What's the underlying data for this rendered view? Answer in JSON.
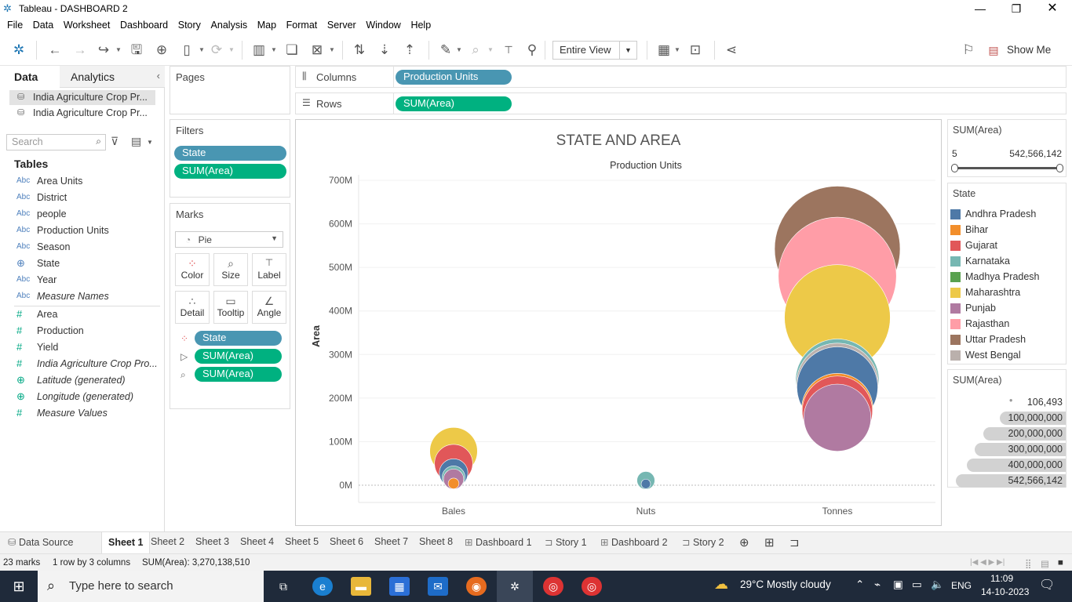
{
  "window": {
    "title": "Tableau - DASHBOARD 2"
  },
  "menu": [
    "File",
    "Data",
    "Worksheet",
    "Dashboard",
    "Story",
    "Analysis",
    "Map",
    "Format",
    "Server",
    "Window",
    "Help"
  ],
  "toolbar": {
    "view_fit": "Entire View",
    "show_me": "Show Me"
  },
  "left_panel": {
    "tab_data": "Data",
    "tab_analytics": "Analytics",
    "datasources": [
      "India Agriculture Crop Pr...",
      "India Agriculture Crop Pr..."
    ],
    "search_placeholder": "Search",
    "tables_heading": "Tables",
    "dimensions": [
      {
        "type": "Abc",
        "name": "Area Units"
      },
      {
        "type": "Abc",
        "name": "District"
      },
      {
        "type": "Abc",
        "name": "people"
      },
      {
        "type": "Abc",
        "name": "Production Units"
      },
      {
        "type": "Abc",
        "name": "Season"
      },
      {
        "type": "globe",
        "name": "State"
      },
      {
        "type": "Abc",
        "name": "Year"
      },
      {
        "type": "Abc",
        "name": "Measure Names"
      }
    ],
    "measures": [
      {
        "type": "#",
        "name": "Area"
      },
      {
        "type": "#",
        "name": "Production"
      },
      {
        "type": "#",
        "name": "Yield"
      },
      {
        "type": "#",
        "name": "India Agriculture Crop Pro..."
      },
      {
        "type": "globe",
        "name": "Latitude (generated)"
      },
      {
        "type": "globe",
        "name": "Longitude (generated)"
      },
      {
        "type": "#",
        "name": "Measure Values"
      }
    ]
  },
  "cards": {
    "pages": "Pages",
    "filters": "Filters",
    "filter_pills": [
      "State",
      "SUM(Area)"
    ],
    "marks": "Marks",
    "mark_type": "Pie",
    "mark_buttons": [
      "Color",
      "Size",
      "Label",
      "Detail",
      "Tooltip",
      "Angle"
    ],
    "mark_pills": [
      "State",
      "SUM(Area)",
      "SUM(Area)"
    ]
  },
  "shelves": {
    "columns_label": "Columns",
    "columns_pill": "Production Units",
    "rows_label": "Rows",
    "rows_pill": "SUM(Area)"
  },
  "chart_data": {
    "type": "scatter",
    "title": "STATE AND AREA",
    "subtitle": "Production Units",
    "ylabel": "Area",
    "categories": [
      "Bales",
      "Nuts",
      "Tonnes"
    ],
    "yticks": [
      "0M",
      "100M",
      "200M",
      "300M",
      "400M",
      "500M",
      "600M",
      "700M"
    ],
    "ylim": [
      0,
      700
    ],
    "unit": "millions",
    "points": [
      {
        "category": "Bales",
        "state": "Maharashtra",
        "y": 78
      },
      {
        "category": "Bales",
        "state": "Gujarat",
        "y": 50
      },
      {
        "category": "Bales",
        "state": "Andhra Pradesh",
        "y": 28
      },
      {
        "category": "Bales",
        "state": "Karnataka",
        "y": 18
      },
      {
        "category": "Bales",
        "state": "Punjab",
        "y": 14
      },
      {
        "category": "Bales",
        "state": "Bihar",
        "y": 4
      },
      {
        "category": "Nuts",
        "state": "Karnataka",
        "y": 11
      },
      {
        "category": "Nuts",
        "state": "Andhra Pradesh",
        "y": 3
      },
      {
        "category": "Tonnes",
        "state": "Uttar Pradesh",
        "y": 542.6
      },
      {
        "category": "Tonnes",
        "state": "Rajasthan",
        "y": 480
      },
      {
        "category": "Tonnes",
        "state": "Maharashtra",
        "y": 385
      },
      {
        "category": "Tonnes",
        "state": "Karnataka",
        "y": 240
      },
      {
        "category": "Tonnes",
        "state": "West Bengal",
        "y": 232
      },
      {
        "category": "Tonnes",
        "state": "Andhra Pradesh",
        "y": 225
      },
      {
        "category": "Tonnes",
        "state": "Bihar",
        "y": 175
      },
      {
        "category": "Tonnes",
        "state": "Gujarat",
        "y": 170
      },
      {
        "category": "Tonnes",
        "state": "Punjab",
        "y": 155
      }
    ]
  },
  "area_filter": {
    "title": "SUM(Area)",
    "min": "5",
    "max": "542,566,142"
  },
  "state_legend": {
    "title": "State",
    "items": [
      {
        "name": "Andhra Pradesh",
        "color": "#4e79a7"
      },
      {
        "name": "Bihar",
        "color": "#f28e2b"
      },
      {
        "name": "Gujarat",
        "color": "#e15759"
      },
      {
        "name": "Karnataka",
        "color": "#76b7b2"
      },
      {
        "name": "Madhya Pradesh",
        "color": "#59a14f"
      },
      {
        "name": "Maharashtra",
        "color": "#edc948"
      },
      {
        "name": "Punjab",
        "color": "#b07aa1"
      },
      {
        "name": "Rajasthan",
        "color": "#ff9da7"
      },
      {
        "name": "Uttar Pradesh",
        "color": "#9c755f"
      },
      {
        "name": "West Bengal",
        "color": "#bab0ac"
      }
    ]
  },
  "size_legend": {
    "title": "SUM(Area)",
    "items": [
      {
        "label": "106,493",
        "fraction": 0.0
      },
      {
        "label": "100,000,000",
        "fraction": 0.6
      },
      {
        "label": "200,000,000",
        "fraction": 0.75
      },
      {
        "label": "300,000,000",
        "fraction": 0.83
      },
      {
        "label": "400,000,000",
        "fraction": 0.9
      },
      {
        "label": "542,566,142",
        "fraction": 1.0
      }
    ]
  },
  "sheet_tabs": [
    "Data Source",
    "Sheet 1",
    "Sheet 2",
    "Sheet 3",
    "Sheet 4",
    "Sheet 5",
    "Sheet 6",
    "Sheet 7",
    "Sheet 8",
    "Dashboard 1",
    "Story 1",
    "Dashboard 2",
    "Story 2"
  ],
  "status": {
    "marks": "23 marks",
    "layout": "1 row by 3 columns",
    "sum": "SUM(Area): 3,270,138,510"
  },
  "taskbar": {
    "search_placeholder": "Type here to search",
    "weather": "29°C  Mostly cloudy",
    "lang": "ENG",
    "time": "11:09",
    "date": "14-10-2023"
  }
}
